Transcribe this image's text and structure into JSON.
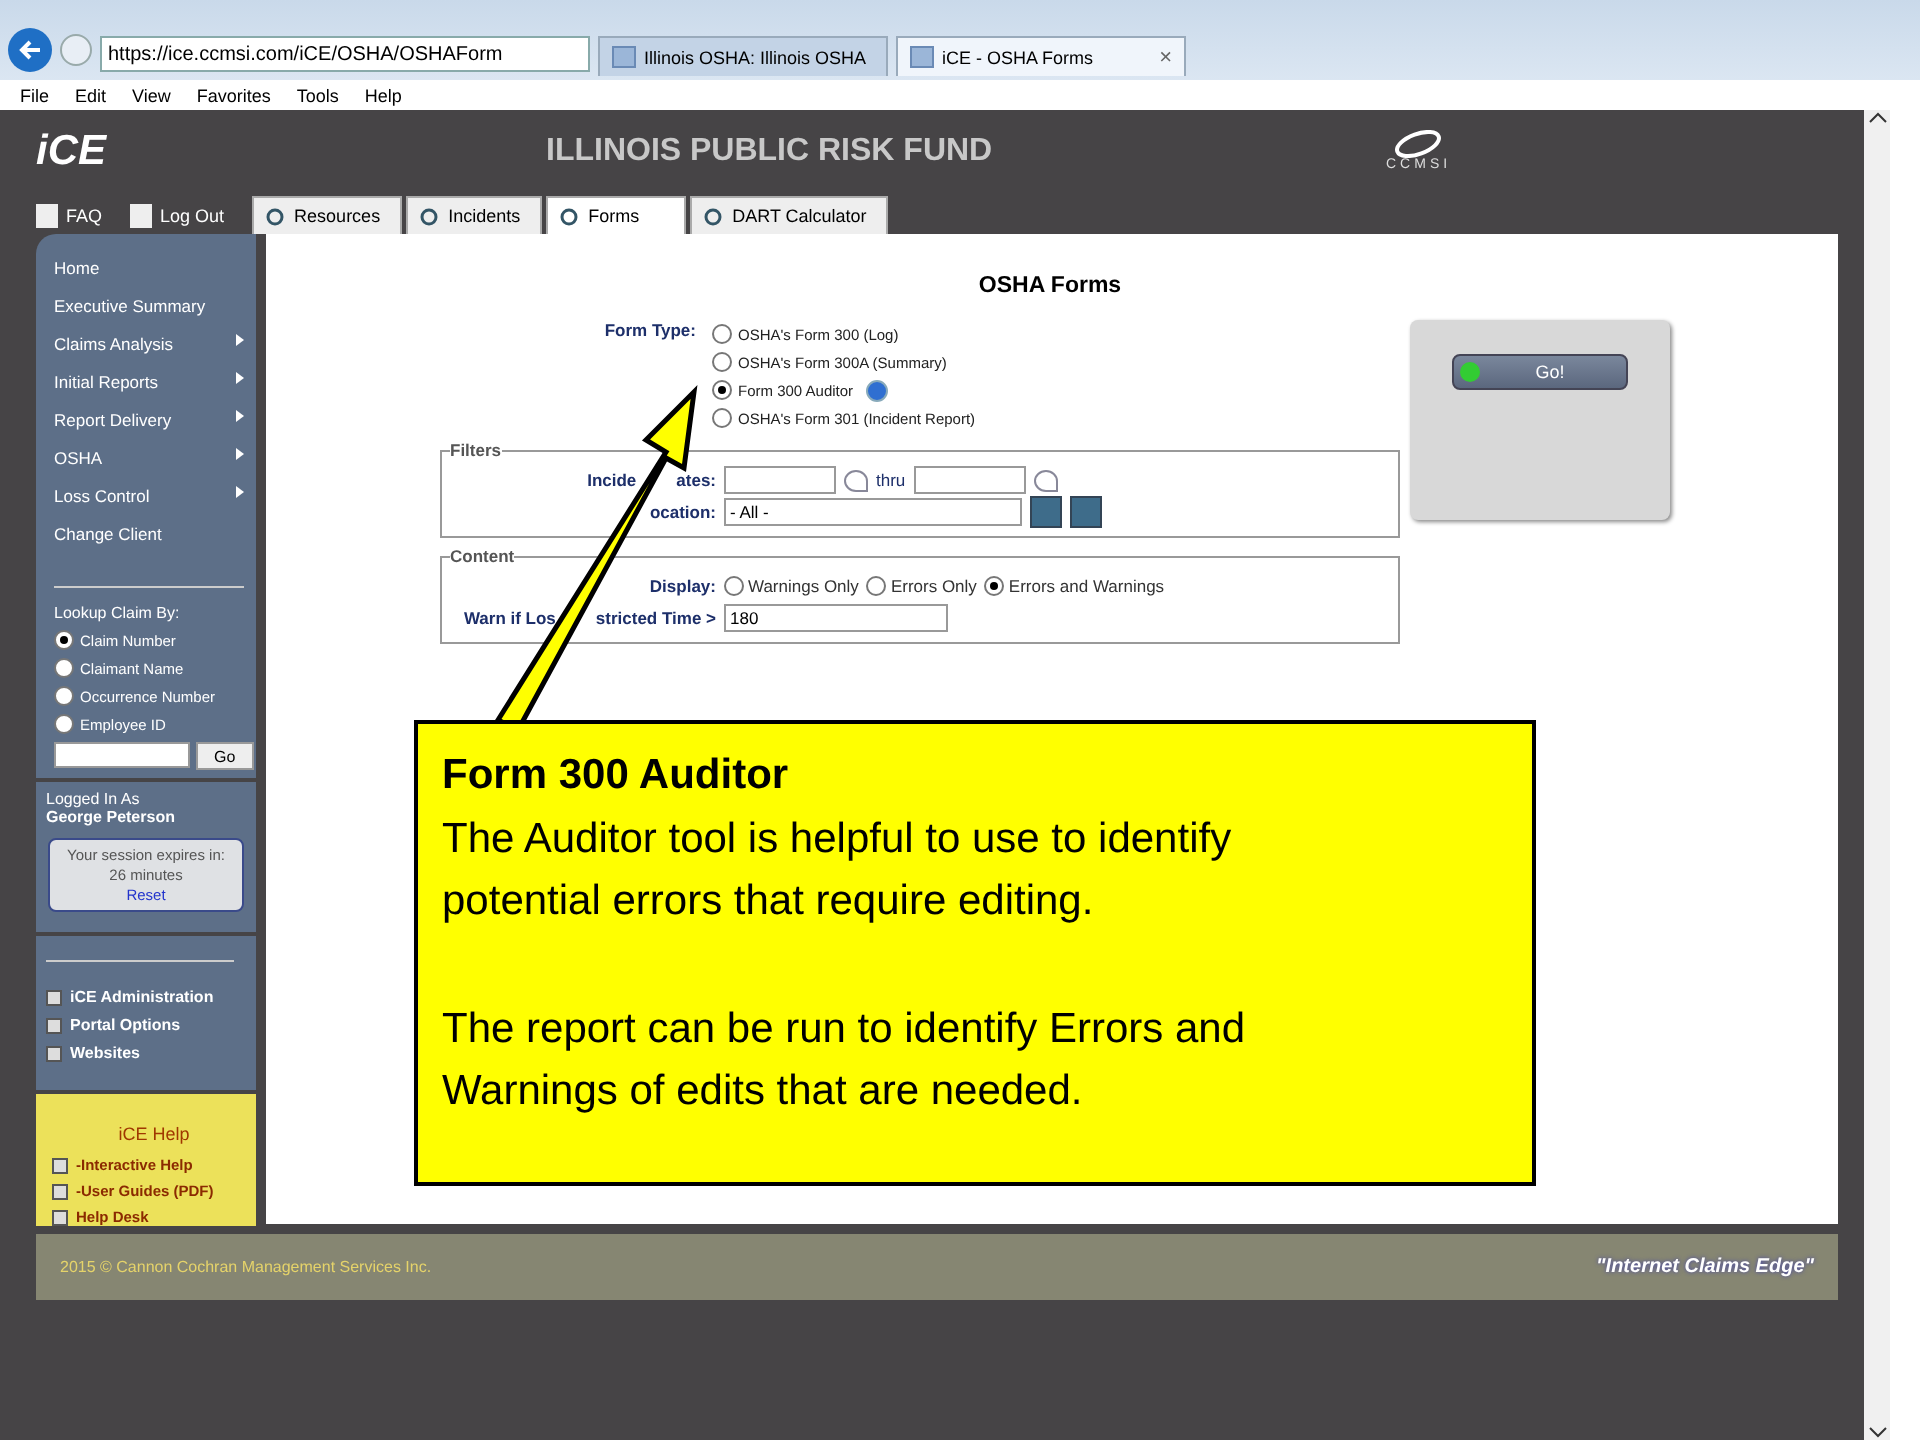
{
  "browser": {
    "address": "https://ice.ccmsi.com/iCE/OSHA/OSHAForm",
    "tabs": [
      {
        "label": "Illinois OSHA: Illinois OSHA",
        "selected": false
      },
      {
        "label": "iCE - OSHA Forms",
        "selected": true,
        "close": "×"
      }
    ],
    "menu": [
      "File",
      "Edit",
      "View",
      "Favorites",
      "Tools",
      "Help"
    ]
  },
  "header": {
    "logo": "iCE",
    "title": "ILLINOIS PUBLIC RISK FUND",
    "brand": "CCMSI"
  },
  "nav_links": [
    "FAQ",
    "Log Out"
  ],
  "tabs": [
    {
      "label": "Resources",
      "selected": false
    },
    {
      "label": "Incidents",
      "selected": false
    },
    {
      "label": "Forms",
      "selected": true
    },
    {
      "label": "DART Calculator",
      "selected": false
    }
  ],
  "sidebar": {
    "items": [
      {
        "label": "Home",
        "submenu": false
      },
      {
        "label": "Executive Summary",
        "submenu": false
      },
      {
        "label": "Claims Analysis",
        "submenu": true
      },
      {
        "label": "Initial Reports",
        "submenu": true
      },
      {
        "label": "Report Delivery",
        "submenu": true
      },
      {
        "label": "OSHA",
        "submenu": true
      },
      {
        "label": "Loss Control",
        "submenu": true
      },
      {
        "label": "Change Client",
        "submenu": false
      }
    ],
    "lookup": {
      "title": "Lookup Claim By:",
      "options": [
        {
          "label": "Claim Number",
          "selected": true
        },
        {
          "label": "Claimant Name",
          "selected": false
        },
        {
          "label": "Occurrence Number",
          "selected": false
        },
        {
          "label": "Employee ID",
          "selected": false
        }
      ],
      "button": "Go"
    },
    "logged_in": {
      "label": "Logged In As",
      "user": "George Peterson"
    },
    "session": {
      "text": "Your session expires in:",
      "minutes": "26 minutes",
      "link": "Reset"
    },
    "links": [
      "iCE Administration",
      "Portal Options",
      "Websites"
    ],
    "help": {
      "title": "iCE Help",
      "items": [
        "-Interactive Help",
        "-User Guides (PDF)",
        "Help Desk"
      ]
    }
  },
  "form": {
    "title": "OSHA Forms",
    "form_type": {
      "label": "Form Type:",
      "options": [
        {
          "label": "OSHA's Form 300 (Log)",
          "selected": false,
          "help": false
        },
        {
          "label": "OSHA's Form 300A (Summary)",
          "selected": false,
          "help": false
        },
        {
          "label": "Form 300 Auditor",
          "selected": true,
          "help": true
        },
        {
          "label": "OSHA's Form 301 (Incident Report)",
          "selected": false,
          "help": false
        }
      ]
    },
    "filters": {
      "legend": "Filters",
      "dates_label": [
        "Incide",
        "ates:"
      ],
      "thru": "thru",
      "location_label": "ocation:",
      "location_value": "- All -"
    },
    "content": {
      "legend": "Content",
      "display_label": "Display:",
      "display_options": [
        {
          "label": "Warnings Only",
          "selected": false
        },
        {
          "label": "Errors Only",
          "selected": false
        },
        {
          "label": "Errors and Warnings",
          "selected": true
        }
      ],
      "warn_label": [
        "Warn if Los",
        "stricted Time >"
      ],
      "warn_value": "180"
    },
    "go_button": "Go!"
  },
  "footer": {
    "copyright": "2015 © Cannon Cochran Management Services Inc.",
    "tagline": "\"Internet Claims Edge\""
  },
  "callout": {
    "title": "Form 300 Auditor",
    "paragraphs": [
      "The Auditor tool is helpful to use to identify potential errors that require editing.",
      "The report can be run to identify Errors and Warnings of edits that are needed."
    ]
  }
}
